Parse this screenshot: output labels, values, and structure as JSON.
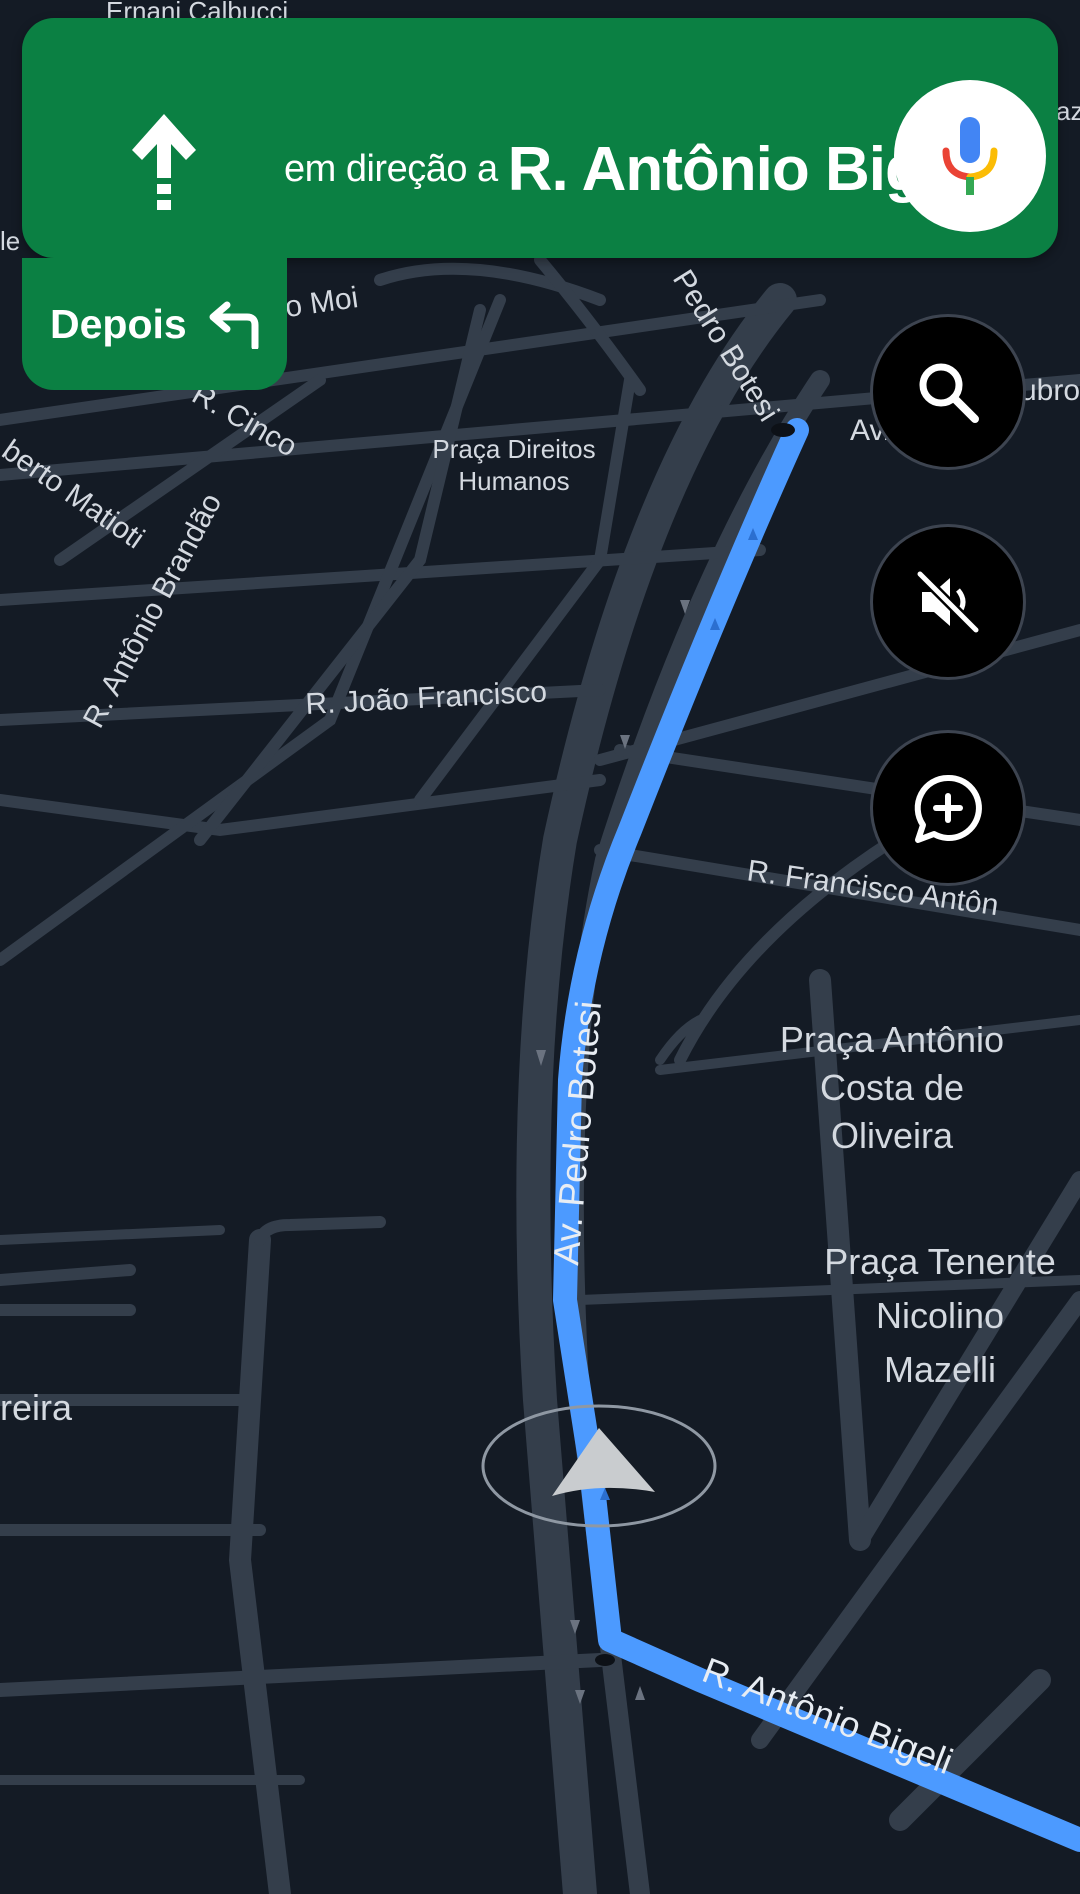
{
  "navigation": {
    "direction_prefix": "em direção a",
    "direction_street": "R. Antônio Bigeli",
    "next_maneuver_label": "Depois",
    "next_maneuver_icon": "turn-left-arrow-icon",
    "current_maneuver_icon": "straight-arrow-icon"
  },
  "buttons": {
    "mic": "microphone-icon",
    "search": "search-icon",
    "mute": "volume-off-icon",
    "report": "report-add-comment-icon"
  },
  "map": {
    "streets": {
      "ernani": "Ernani Calbucci",
      "moi": "io Moi",
      "cinco": "R. Cinco",
      "matioti": "berto Matioti",
      "brandao": "R. Antônio Brandão",
      "pedro_top": "Pedro Botesi",
      "av_right": "Av.",
      "ubro": "ubro",
      "azi": "azi",
      "left_edge": "le",
      "joao": "R. João Francisco",
      "francisco_antonio": "R. Francisco Antôn",
      "pedro_main": "Av. Pedro Botesi",
      "bigeli": "R. Antônio Bigeli",
      "reira": "reira"
    },
    "places": {
      "direitos_line1": "Praça Direitos",
      "direitos_line2": "Humanos",
      "costa_line1": "Praça Antônio",
      "costa_line2": "Costa de",
      "costa_line3": "Oliveira",
      "tenente_line1": "Praça Tenente",
      "tenente_line2": "Nicolino",
      "tenente_line3": "Mazelli"
    },
    "colors": {
      "background": "#141b25",
      "road": "#343e4b",
      "route": "#4c9aff",
      "banner": "#0b8043"
    }
  }
}
